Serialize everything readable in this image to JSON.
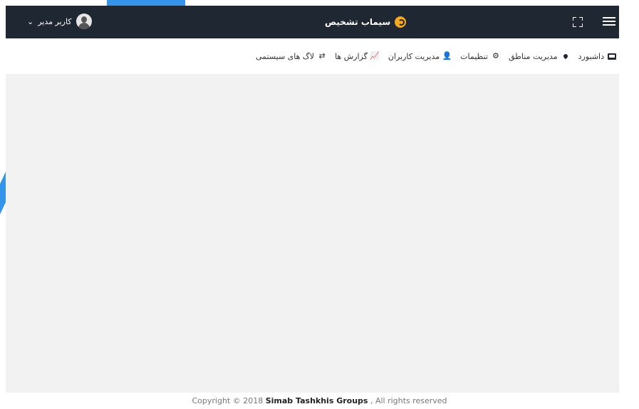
{
  "header": {
    "brand": "سیماب تشخیص",
    "user_label": "کاربر مدیر",
    "user_caret": "⌄"
  },
  "nav": {
    "items": [
      {
        "label": "داشبورد",
        "icon": "monitor-icon"
      },
      {
        "label": "مدیریت مناطق",
        "icon": "map-pin-icon"
      },
      {
        "label": "تنظیمات",
        "icon": "gears-icon"
      },
      {
        "label": "مدیریت کاربران",
        "icon": "users-icon"
      },
      {
        "label": "گزارش ها",
        "icon": "chart-icon"
      },
      {
        "label": "لاگ های سیستمی",
        "icon": "exchange-icon"
      }
    ]
  },
  "footer": {
    "prefix": "Copyright © 2018 ",
    "company": "Simab Tashkhis Groups",
    "suffix": " , All rights reserved"
  }
}
